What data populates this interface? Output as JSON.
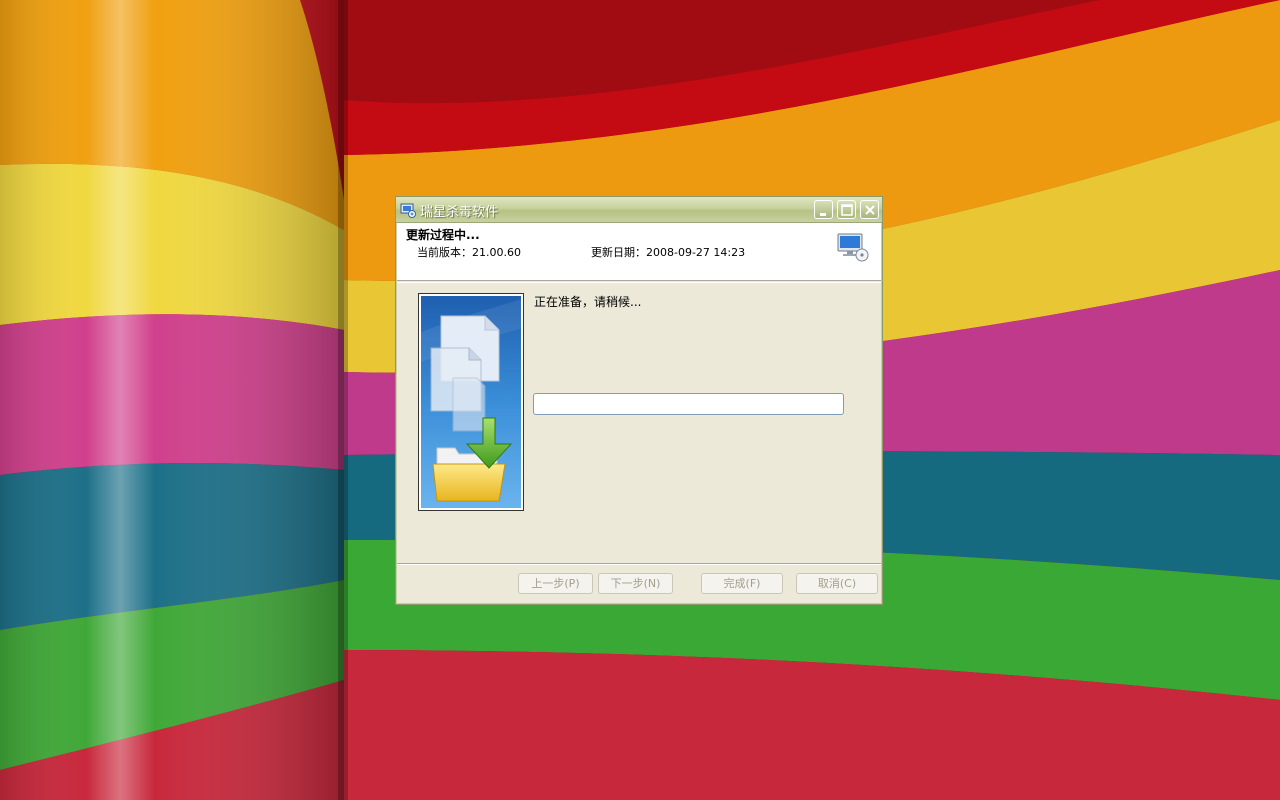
{
  "window": {
    "title": "瑞星杀毒软件",
    "header": {
      "title": "更新过程中...",
      "version_text": "当前版本：21.00.60",
      "date_text": "更新日期：2008-09-27 14:23"
    },
    "status_text": "正在准备，请稍候...",
    "progress": 0,
    "buttons": {
      "prev": "上一步(P)",
      "next": "下一步(N)",
      "finish": "完成(F)",
      "cancel": "取消(C)"
    }
  },
  "colors": {
    "titlebar": "#c6d29c",
    "dialog_bg": "#ece9d8",
    "illustration_blue": "#3a8ed8",
    "arrow_green": "#5dbb2f",
    "folder_yellow": "#f6d040"
  },
  "icons": {
    "app": "rising-antivirus-icon",
    "header": "computer-update-icon",
    "illustration": "download-files-to-folder-illustration"
  }
}
